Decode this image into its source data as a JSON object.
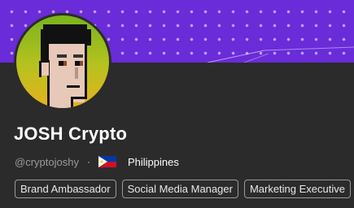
{
  "profile": {
    "name": "JOSH Crypto",
    "handle": "@cryptojoshy",
    "separator": "·",
    "country": "Philippines",
    "flag_icon": "philippines-flag-icon",
    "tags": [
      "Brand Ambassador",
      "Social Media Manager",
      "Marketing Executive"
    ]
  },
  "colors": {
    "banner": "#6a2bd9",
    "background": "#2b2b2b",
    "avatar_bg": "#9cc21e"
  }
}
